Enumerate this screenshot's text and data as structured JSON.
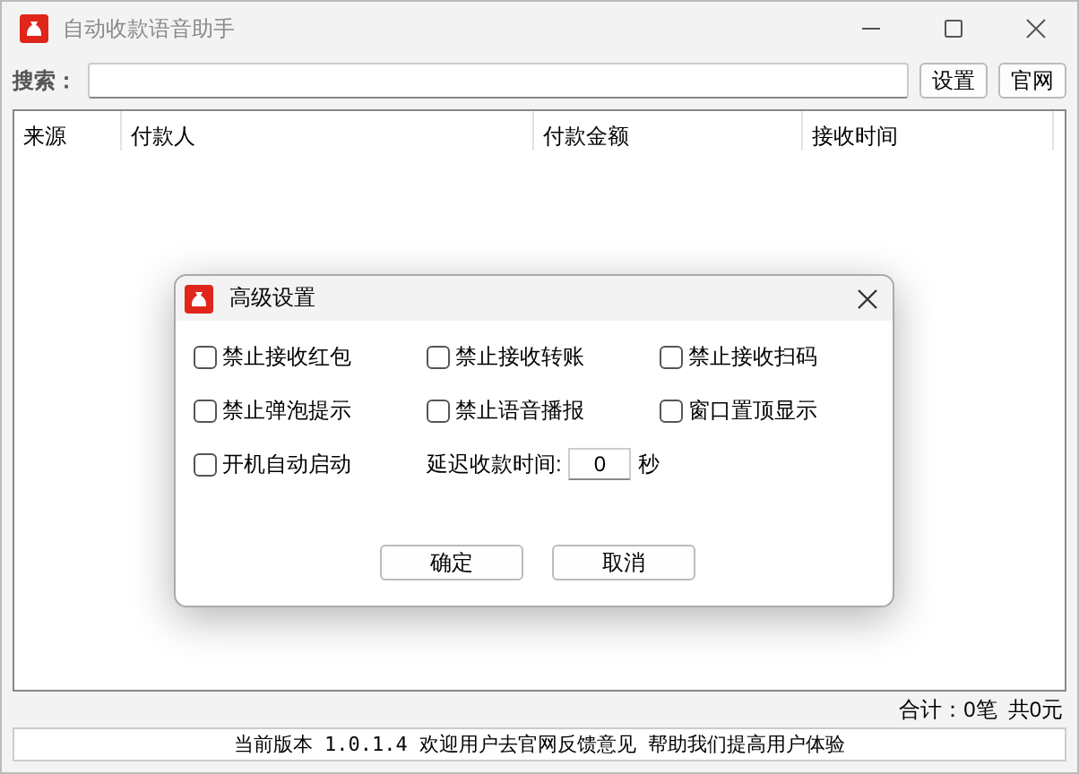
{
  "window": {
    "title": "自动收款语音助手",
    "active": false
  },
  "search": {
    "label": "搜索："
  },
  "toolbar_buttons": [
    "设置",
    "官网"
  ],
  "table": {
    "columns": [
      "来源",
      "付款人",
      "付款金额",
      "接收时间"
    ]
  },
  "summary": [
    "合计：0笔",
    "共0元"
  ],
  "status_bar": "当前版本 1.0.1.4 欢迎用户去官网反馈意见 帮助我们提高用户体验",
  "dialog": {
    "title": "高级设置",
    "options": [
      {
        "label": "禁止接收红包",
        "checked": false
      },
      {
        "label": "禁止接收转账",
        "checked": false
      },
      {
        "label": "禁止接收扫码",
        "checked": false
      },
      {
        "label": "禁止弹泡提示",
        "checked": false
      },
      {
        "label": "禁止语音播报",
        "checked": false
      },
      {
        "label": "窗口置顶显示",
        "checked": false
      },
      {
        "label": "开机自动启动",
        "checked": false
      }
    ],
    "delay": {
      "label": "延迟收款时间:",
      "value": "0",
      "unit": "秒"
    },
    "buttons": [
      "确定",
      "取消"
    ]
  }
}
